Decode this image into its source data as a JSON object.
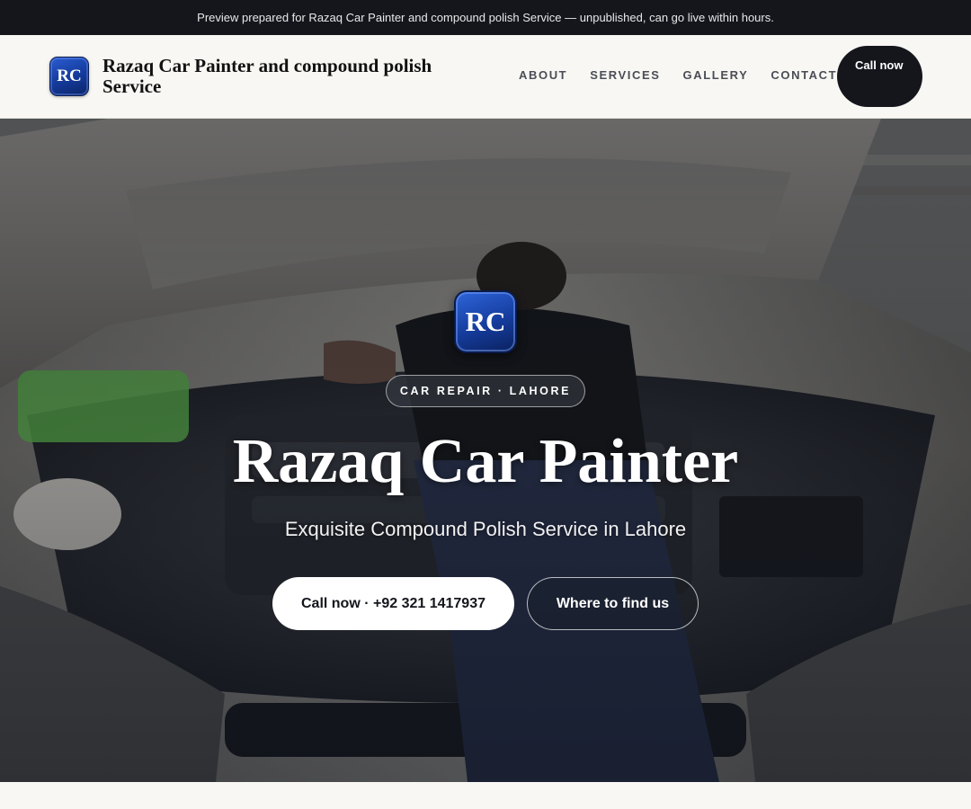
{
  "announcement": "Preview prepared for Razaq Car Painter and compound polish Service — unpublished, can go live within hours.",
  "header": {
    "logo_initials": "RC",
    "brand_name": "Razaq Car Painter and compound polish Service",
    "nav": [
      "ABOUT",
      "SERVICES",
      "GALLERY",
      "CONTACT"
    ],
    "call_label": "Call now"
  },
  "hero": {
    "badge_initials": "RC",
    "tag": "CAR REPAIR · LAHORE",
    "title": "Razaq Car Painter",
    "subtitle": "Exquisite Compound Polish Service in Lahore",
    "primary_button": "Call now · +92 321 1417937",
    "secondary_button": "Where to find us"
  },
  "colors": {
    "topbar_bg": "#14161c",
    "accent_blue": "#1d4bb8",
    "button_dark": "#14161c"
  }
}
